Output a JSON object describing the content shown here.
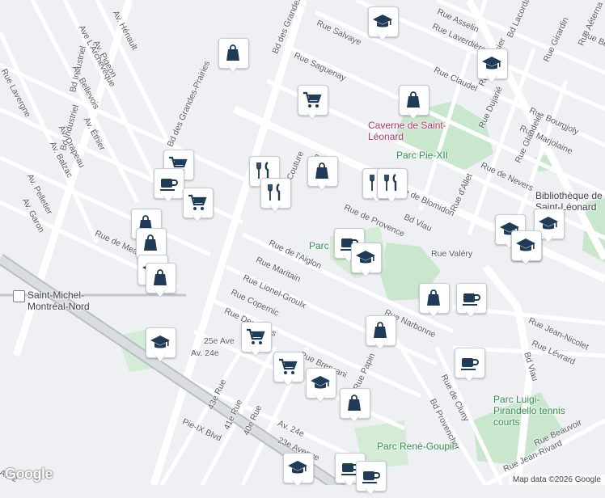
{
  "map": {
    "streets": [
      {
        "name": "Bd Industriel",
        "angle": -74
      },
      {
        "name": "Bd Industriel",
        "angle": -77
      },
      {
        "name": "Av. Hénault",
        "angle": 62
      },
      {
        "name": "Av. Pigeon",
        "angle": 62
      },
      {
        "name": "Ave L'Archevêque",
        "angle": 62
      },
      {
        "name": "Av. Bellevois",
        "angle": 62
      },
      {
        "name": "Av. Éthier",
        "angle": 62
      },
      {
        "name": "Av. Drapeau",
        "angle": 62
      },
      {
        "name": "Av. Balzac",
        "angle": 62
      },
      {
        "name": "Av. Pelletier",
        "angle": 62
      },
      {
        "name": "Av. Garon",
        "angle": 62
      },
      {
        "name": "Rue Lavergne",
        "angle": 62
      },
      {
        "name": "Bd des Grandes-Prairies",
        "angle": -67
      },
      {
        "name": "Bd des Grandes-Prairies",
        "angle": -66
      },
      {
        "name": "Rue Salvaye",
        "angle": 25
      },
      {
        "name": "Rue Saguenay",
        "angle": 25
      },
      {
        "name": "Rue Asselin",
        "angle": 25
      },
      {
        "name": "Rue Laverdière",
        "angle": 25
      },
      {
        "name": "Rue Claudel",
        "angle": 25
      },
      {
        "name": "Rue Bourgjoly",
        "angle": 25
      },
      {
        "name": "Rue Marjolaine",
        "angle": 25
      },
      {
        "name": "Rue de Nevers",
        "angle": 25
      },
      {
        "name": "Rue Belherbe",
        "angle": 25
      },
      {
        "name": "Rue Aéterna",
        "angle": -65
      },
      {
        "name": "Rue Girardin",
        "angle": -65
      },
      {
        "name": "Rue Dujarié",
        "angle": -65
      },
      {
        "name": "Rue Glandelet",
        "angle": -65
      },
      {
        "name": "Rue d'Allet",
        "angle": -65
      },
      {
        "name": "Bd Lacordaire",
        "angle": -65
      },
      {
        "name": "Rue Lavoisier",
        "angle": -65
      },
      {
        "name": "Rue de Blomidon",
        "angle": 25
      },
      {
        "name": "Rue de Provence",
        "angle": 25
      },
      {
        "name": "Rue de Meaux",
        "angle": 25
      },
      {
        "name": "Rue de l'Aiglon",
        "angle": 25
      },
      {
        "name": "Rue Maritain",
        "angle": 25
      },
      {
        "name": "Rue Lionel-Groulx",
        "angle": 25
      },
      {
        "name": "Rue Copernic",
        "angle": 25
      },
      {
        "name": "Rue Descartes",
        "angle": 25
      },
      {
        "name": "Rue Narbonne",
        "angle": 25
      },
      {
        "name": "Rue Jean-Nicolet",
        "angle": 25
      },
      {
        "name": "Rue Lévrard",
        "angle": 25
      },
      {
        "name": "Rue Bressani",
        "angle": 25
      },
      {
        "name": "Rue Papin",
        "angle": -65
      },
      {
        "name": "Rue de Cluny",
        "angle": 63
      },
      {
        "name": "Bd Provencher",
        "angle": 63
      },
      {
        "name": "Rue Jean-Rivard",
        "angle": -25
      },
      {
        "name": "Rue Beauvoir",
        "angle": -25
      },
      {
        "name": "Bd Viau",
        "angle": 25
      },
      {
        "name": "Bd Viau",
        "angle": 73
      },
      {
        "name": "Rue Valéry",
        "angle": 0
      },
      {
        "name": "25e Ave",
        "angle": 0
      },
      {
        "name": "Av. 24e",
        "angle": 0
      },
      {
        "name": "43e Rue",
        "angle": -65
      },
      {
        "name": "41e Rue",
        "angle": -65
      },
      {
        "name": "40e Rue",
        "angle": -65
      },
      {
        "name": "Av. 24e",
        "angle": 25
      },
      {
        "name": "23e Avenue",
        "angle": 25
      },
      {
        "name": "Pie-IX Blvd",
        "angle": 25
      },
      {
        "name": "Couture",
        "angle": -67
      },
      {
        "name": "Bd",
        "angle": 25
      },
      {
        "name": "Av. 2",
        "angle": 25
      }
    ],
    "pois": [
      {
        "name": "Caverne de Saint-Léonard",
        "type": "attraction"
      },
      {
        "name": "Parc Pie-XII",
        "type": "park"
      },
      {
        "name": "Bibliothèque de Saint-Léonard",
        "type": "library"
      },
      {
        "name": "Parc",
        "type": "park"
      },
      {
        "name": "Parc Luigi-Pirandello tennis courts",
        "type": "park"
      },
      {
        "name": "Parc René-Goupil",
        "type": "park"
      },
      {
        "name": "Saint-Michel-Montréal-Nord",
        "type": "station"
      }
    ],
    "markers": [
      {
        "icon": "school"
      },
      {
        "icon": "shopping-bag"
      },
      {
        "icon": "shopping-cart"
      },
      {
        "icon": "shopping-bag"
      },
      {
        "icon": "school"
      },
      {
        "icon": "school"
      },
      {
        "icon": "shopping-cart"
      },
      {
        "icon": "coffee"
      },
      {
        "icon": "shopping-cart"
      },
      {
        "icon": "restaurant"
      },
      {
        "icon": "restaurant"
      },
      {
        "icon": "shopping-bag"
      },
      {
        "icon": "restaurant"
      },
      {
        "icon": "shopping-bag"
      },
      {
        "icon": "shopping-bag"
      },
      {
        "icon": "school"
      },
      {
        "icon": "shopping-bag"
      },
      {
        "icon": "coffee"
      },
      {
        "icon": "school"
      },
      {
        "icon": "school"
      },
      {
        "icon": "school"
      },
      {
        "icon": "shopping-bag"
      },
      {
        "icon": "coffee"
      },
      {
        "icon": "school"
      },
      {
        "icon": "shopping-bag"
      },
      {
        "icon": "shopping-cart"
      },
      {
        "icon": "shopping-cart"
      },
      {
        "icon": "school"
      },
      {
        "icon": "shopping-bag"
      },
      {
        "icon": "coffee"
      },
      {
        "icon": "school"
      },
      {
        "icon": "coffee"
      },
      {
        "icon": "coffee"
      },
      {
        "icon": "school"
      },
      {
        "icon": "restaurant"
      }
    ],
    "attribution": "Map data ©2026 Google",
    "logo": "Google"
  }
}
